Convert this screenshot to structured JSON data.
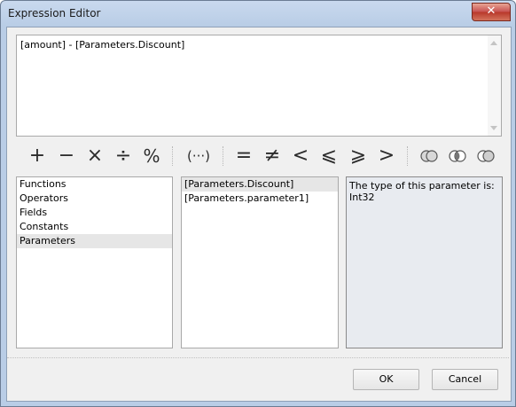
{
  "window": {
    "title": "Expression Editor",
    "close_glyph": "✕"
  },
  "expression": {
    "text": "[amount] - [Parameters.Discount]"
  },
  "toolbar": {
    "operators": [
      {
        "name": "plus",
        "glyph": "+"
      },
      {
        "name": "minus",
        "glyph": "−"
      },
      {
        "name": "multiply",
        "glyph": "×"
      },
      {
        "name": "divide",
        "glyph": "÷"
      },
      {
        "name": "percent",
        "glyph": "%"
      },
      {
        "name": "parentheses",
        "glyph": "(···)"
      },
      {
        "name": "equals",
        "glyph": "="
      },
      {
        "name": "not-equal",
        "glyph": "≠"
      },
      {
        "name": "less-than",
        "glyph": "<"
      },
      {
        "name": "less-or-equal",
        "glyph": "⩽"
      },
      {
        "name": "greater-or-equal",
        "glyph": "⩾"
      },
      {
        "name": "greater-than",
        "glyph": ">"
      },
      {
        "name": "or-icon",
        "glyph": ""
      },
      {
        "name": "and-icon",
        "glyph": ""
      },
      {
        "name": "not-icon",
        "glyph": ""
      }
    ]
  },
  "categories": {
    "items": [
      "Functions",
      "Operators",
      "Fields",
      "Constants",
      "Parameters"
    ],
    "selected": "Parameters"
  },
  "parameters": {
    "items": [
      "[Parameters.Discount]",
      "[Parameters.parameter1]"
    ],
    "selected": "[Parameters.Discount]"
  },
  "info": {
    "line1": "The type of this parameter is:",
    "line2": "Int32"
  },
  "buttons": {
    "ok": "OK",
    "cancel": "Cancel"
  }
}
